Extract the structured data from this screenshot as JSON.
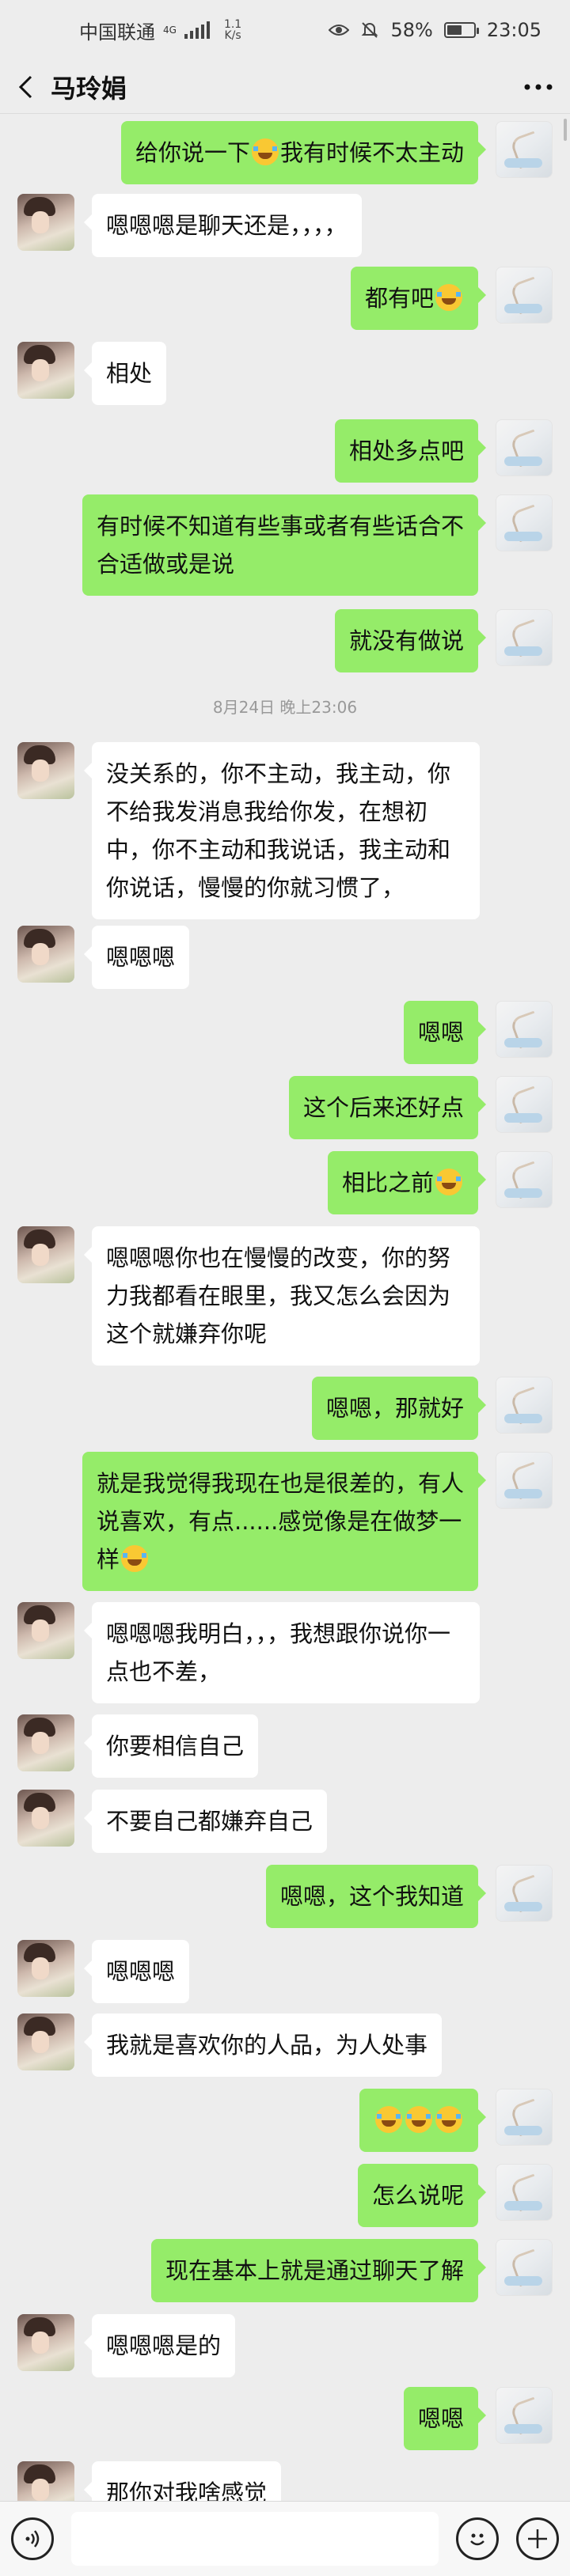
{
  "status_bar": {
    "carrier": "中国联通",
    "network": "4G",
    "speed_value": "1.1",
    "speed_unit": "K/s",
    "battery": "58%",
    "time": "23:05"
  },
  "header": {
    "title": "马玲娟",
    "more_label": "···"
  },
  "timestamp": "8月24日 晚上23:06",
  "messages": [
    {
      "side": "right",
      "text": "给你说一下[emoji]我有时候不太主动"
    },
    {
      "side": "left",
      "text": "嗯嗯嗯是聊天还是，，，，"
    },
    {
      "side": "right",
      "text": "都有吧[emoji]"
    },
    {
      "side": "left",
      "text": "相处"
    },
    {
      "side": "right",
      "text": "相处多点吧"
    },
    {
      "side": "right",
      "text": "有时候不知道有些事或者有些话合不合适做或是说"
    },
    {
      "side": "right",
      "text": "就没有做说"
    },
    {
      "side": "left",
      "text": "没关系的，你不主动，我主动，你不给我发消息我给你发，在想初中，你不主动和我说话，我主动和你说话，慢慢的你就习惯了，"
    },
    {
      "side": "left",
      "text": "嗯嗯嗯"
    },
    {
      "side": "right",
      "text": "嗯嗯"
    },
    {
      "side": "right",
      "text": "这个后来还好点"
    },
    {
      "side": "right",
      "text": "相比之前[emoji]"
    },
    {
      "side": "left",
      "text": "嗯嗯嗯你也在慢慢的改变，你的努力我都看在眼里，我又怎么会因为这个就嫌弃你呢"
    },
    {
      "side": "right",
      "text": "嗯嗯，那就好"
    },
    {
      "side": "right",
      "text": "就是我觉得我现在也是很差的，有人说喜欢，有点......感觉像是在做梦一样[emoji]"
    },
    {
      "side": "left",
      "text": "嗯嗯嗯我明白，，，我想跟你说你一点也不差，"
    },
    {
      "side": "left",
      "text": "你要相信自己"
    },
    {
      "side": "left",
      "text": "不要自己都嫌弃自己"
    },
    {
      "side": "right",
      "text": "嗯嗯，这个我知道"
    },
    {
      "side": "left",
      "text": "嗯嗯嗯"
    },
    {
      "side": "left",
      "text": "我就是喜欢你的人品，为人处事"
    },
    {
      "side": "right",
      "text": "[emoji][emoji][emoji]"
    },
    {
      "side": "right",
      "text": "怎么说呢"
    },
    {
      "side": "right",
      "text": "现在基本上就是通过聊天了解"
    },
    {
      "side": "left",
      "text": "嗯嗯嗯是的"
    },
    {
      "side": "right",
      "text": "嗯嗯"
    },
    {
      "side": "left",
      "text": "那你对我啥感觉"
    }
  ],
  "icons": {
    "back": "back-arrow-icon",
    "more": "more-icon",
    "voice": "voice-icon",
    "emoji": "emoji-icon",
    "add": "add-icon",
    "eye": "eye-icon",
    "mute": "mute-icon"
  },
  "colors": {
    "background": "#ededed",
    "bubble_self": "#95ec69",
    "bubble_other": "#ffffff",
    "timestamp": "#999999"
  }
}
